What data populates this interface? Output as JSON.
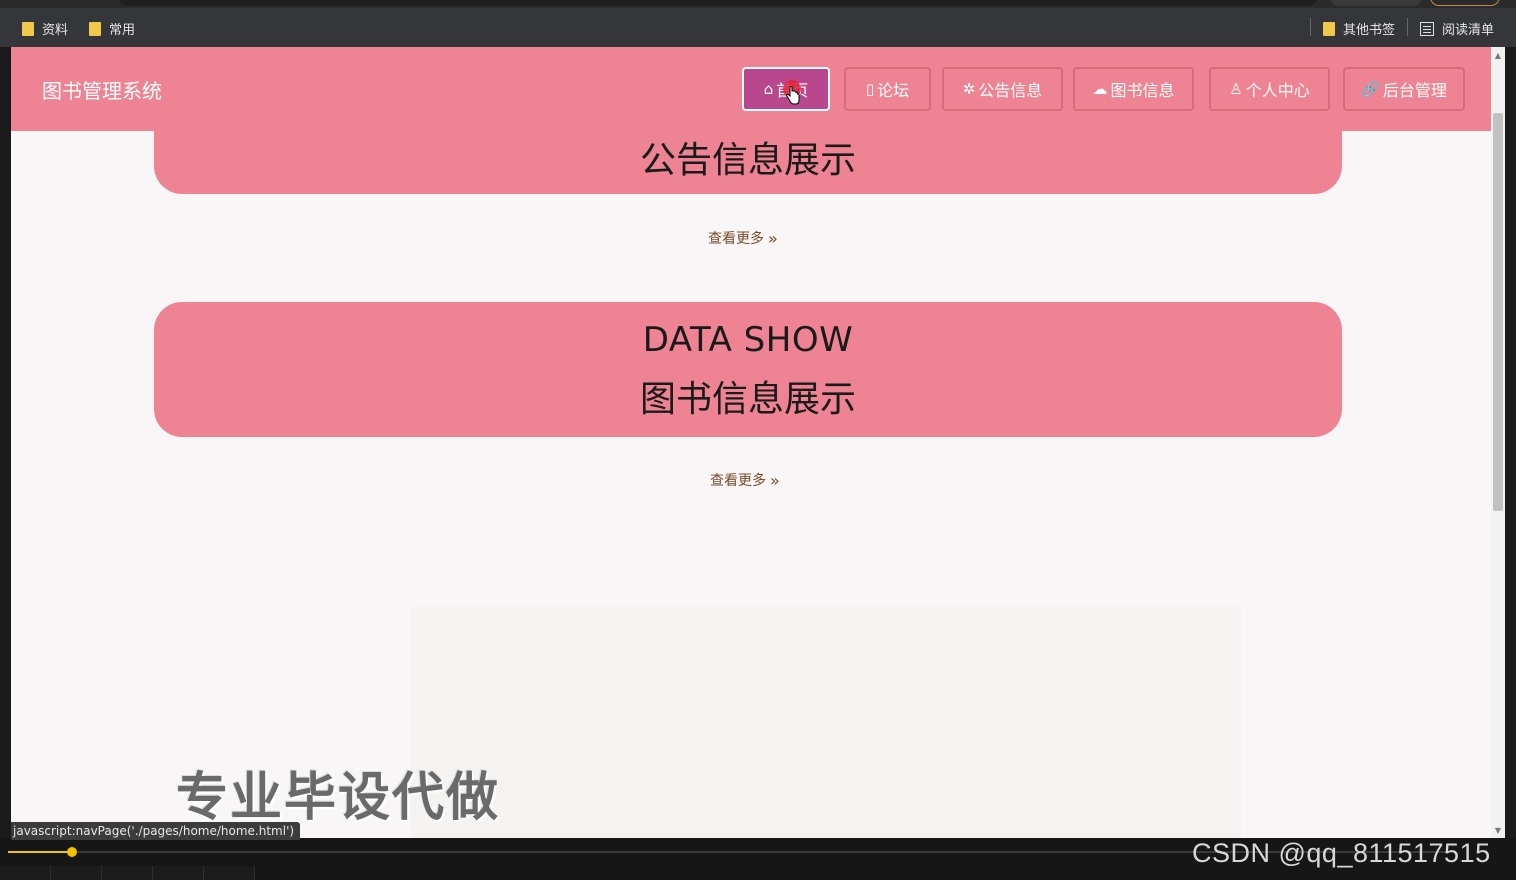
{
  "bookmarks": {
    "left": [
      "资料",
      "常用"
    ],
    "other_label": "其他书签",
    "reading_list_label": "阅读清单"
  },
  "header": {
    "brand": "图书管理系统",
    "nav": [
      {
        "icon": "⌂",
        "label": "首页",
        "active": true
      },
      {
        "icon": "▯",
        "label": "论坛",
        "active": false
      },
      {
        "icon": "✲",
        "label": "公告信息",
        "active": false
      },
      {
        "icon": "☁",
        "label": "图书信息",
        "active": false
      },
      {
        "icon": "♙",
        "label": "个人中心",
        "active": false
      },
      {
        "icon": "🔗",
        "label": "后台管理",
        "active": false
      }
    ]
  },
  "sections": {
    "notice": {
      "title_cn": "公告信息展示",
      "more": "查看更多"
    },
    "books": {
      "title_en": "DATA SHOW",
      "title_cn": "图书信息展示",
      "more": "查看更多"
    }
  },
  "watermark": "专业毕设代做",
  "status_url": "javascript:navPage('./pages/home/home.html')",
  "player": {
    "credit": "CSDN @qq_811517515"
  },
  "colors": {
    "header": "#ee8493",
    "active_nav": "#b8478d",
    "banner": "#ee8493"
  }
}
